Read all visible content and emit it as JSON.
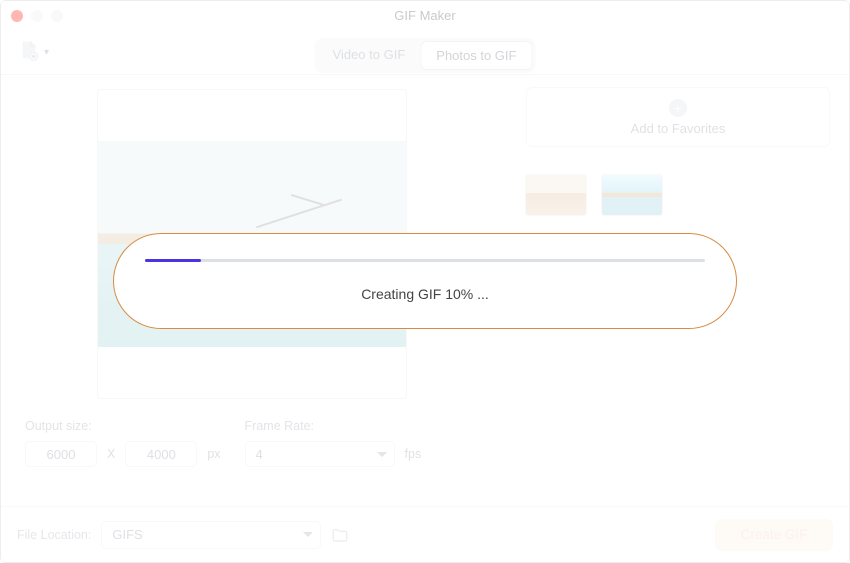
{
  "window": {
    "title": "GIF Maker"
  },
  "tabs": {
    "video": "Video to GIF",
    "photos": "Photos to GIF",
    "active": "photos"
  },
  "favorites": {
    "label": "Add to Favorites"
  },
  "output": {
    "size_label": "Output size:",
    "width": "6000",
    "height": "4000",
    "multiply": "X",
    "unit": "px",
    "framerate_label": "Frame Rate:",
    "framerate_value": "4",
    "framerate_unit": "fps"
  },
  "bottom": {
    "file_location_label": "File Location:",
    "file_location_value": "GIFS",
    "create_label": "Create GIF"
  },
  "progress": {
    "percent": 10,
    "text": "Creating GIF 10% ..."
  },
  "icons": {
    "newdoc": "new-document-icon",
    "chevron": "chevron-down-icon",
    "plus": "plus-circle-icon",
    "folder": "folder-icon"
  },
  "colors": {
    "accent_orange": "#d98b3e",
    "progress_fill": "#4a33e0"
  }
}
